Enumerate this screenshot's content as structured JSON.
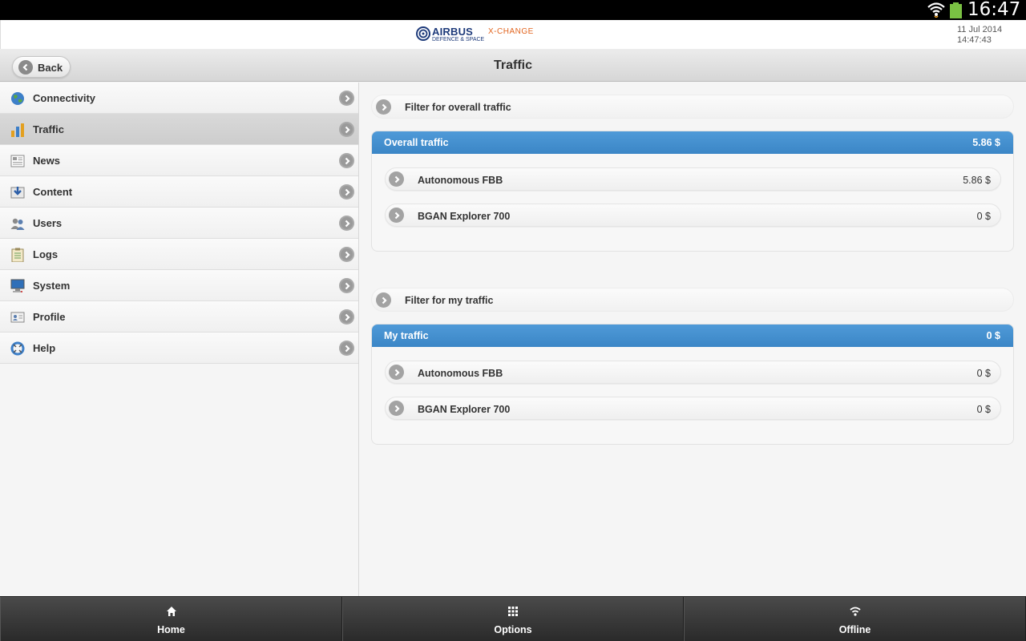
{
  "statusbar": {
    "time": "16:47",
    "wifi_icon": "wifi-icon",
    "battery_icon": "battery-icon"
  },
  "header": {
    "brand_name": "AIRBUS",
    "brand_sub": "DEFENCE & SPACE",
    "product": "X-CHANGE",
    "date": "11 Jul 2014",
    "time": "14:47:43"
  },
  "titlebar": {
    "back_label": "Back",
    "title": "Traffic"
  },
  "sidebar": {
    "items": [
      {
        "label": "Connectivity",
        "icon": "globe-icon"
      },
      {
        "label": "Traffic",
        "icon": "bar-chart-icon",
        "active": true
      },
      {
        "label": "News",
        "icon": "newspaper-icon"
      },
      {
        "label": "Content",
        "icon": "download-icon"
      },
      {
        "label": "Users",
        "icon": "users-icon"
      },
      {
        "label": "Logs",
        "icon": "clipboard-icon"
      },
      {
        "label": "System",
        "icon": "monitor-icon"
      },
      {
        "label": "Profile",
        "icon": "id-card-icon"
      },
      {
        "label": "Help",
        "icon": "lifebuoy-icon"
      }
    ]
  },
  "main": {
    "overall": {
      "filter_label": "Filter for overall traffic",
      "title": "Overall traffic",
      "total": "5.86 $",
      "rows": [
        {
          "label": "Autonomous FBB",
          "value": "5.86 $"
        },
        {
          "label": "BGAN Explorer 700",
          "value": "0 $"
        }
      ]
    },
    "mine": {
      "filter_label": "Filter for my traffic",
      "title": "My traffic",
      "total": "0 $",
      "rows": [
        {
          "label": "Autonomous FBB",
          "value": "0 $"
        },
        {
          "label": "BGAN Explorer 700",
          "value": "0 $"
        }
      ]
    }
  },
  "bottombar": {
    "tabs": [
      {
        "label": "Home",
        "icon": "home-icon"
      },
      {
        "label": "Options",
        "icon": "grid-icon"
      },
      {
        "label": "Offline",
        "icon": "wifi-icon"
      }
    ]
  },
  "colors": {
    "accent_blue": "#3b86c6",
    "brand_orange": "#e2641e",
    "brand_navy": "#1d3a7a"
  }
}
